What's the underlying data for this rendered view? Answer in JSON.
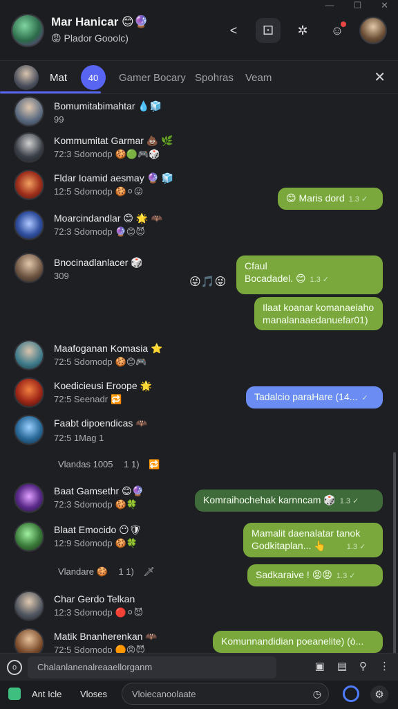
{
  "window": {
    "minimize": "—",
    "maximize": "☐",
    "close": "✕"
  },
  "header": {
    "name": "Mar Hanicar 😊🔮",
    "status": "😡 Plador Gooolc)",
    "actions": [
      "share-icon",
      "dice-icon",
      "settings-icon",
      "notification-icon"
    ]
  },
  "tabs": {
    "me_label": "Mat",
    "badge": "40",
    "items": [
      "Gamer Bocary",
      "Spohras",
      "Veam"
    ],
    "close": "✕"
  },
  "contacts": [
    {
      "name": "Bomumitabimahtar 💧🧊",
      "meta": "99",
      "emoji": ""
    },
    {
      "name": "Kommumitat Garmar 💩 🌿",
      "meta": "72:3 Sdomodp",
      "emoji": "🍪🟢🎮🎲"
    },
    {
      "name": "Fldar Ioamid aesmay 🔮 🧊",
      "meta": "12:5 Sdomodp",
      "emoji": "🍪⚪😜"
    },
    {
      "name": "Moarcindandlar 😊 🌟 🦇",
      "meta": "72:3 Sdomodp",
      "emoji": "🔮😊😈"
    },
    {
      "name": "Bnocinadlanlacer 🎲",
      "meta": "309",
      "emoji": ""
    },
    {
      "name": "Maafoganan Komasia ⭐",
      "meta": "72:5 Sdomodp",
      "emoji": "🍪😊🎮"
    },
    {
      "name": "Koedicieusi Eroope 🌟",
      "meta": "72:5 Seenadr",
      "emoji": "🔁"
    },
    {
      "name": "Faabt dipoendicas 🦇",
      "meta": "72:5 1Mag 1",
      "emoji": ""
    },
    {
      "name": "Baat Gamsethr 😊🔮",
      "meta": "72:3 Sdomodp",
      "emoji": "🍪🍀"
    },
    {
      "name": "Blaat Emocido 😶🛡",
      "meta": "12:9 Sdomodp",
      "emoji": "🍪🍀"
    },
    {
      "name": "Char Gerdo Telkan",
      "meta": "12:3 Sdomodp",
      "emoji": "🔴⚪😈"
    },
    {
      "name": "Matik Bnanherenkan 🦇",
      "meta": "72:5 Sdomodp",
      "emoji": "🟠😡😈"
    }
  ],
  "messages": [
    {
      "text": "😊 Maris dord",
      "tick": "1.3 ✓"
    },
    {
      "text": "Cfaul",
      "text2": "Bocadadel. 😊",
      "tick": "1.3 ✓",
      "reactions": "😜🎵😜"
    },
    {
      "text": "Ilaat koanar komanaeiaho",
      "text2": "manalanaaedanuefar01)"
    },
    {
      "text": "Tadalcio paraHare (14...",
      "tick": "✓"
    },
    {
      "text": "Komraihochehak karnncam 🎲",
      "tick": "1.3 ✓"
    },
    {
      "text": "Mamalit daenalatar tanok",
      "text2": "Godkitaplan... 👆",
      "tick": "1.3 ✓"
    },
    {
      "text": "Sadkaraive ! 😡😡",
      "tick": "1.3 ✓"
    },
    {
      "text": "Komunnandidian poeanelite) (ò..."
    }
  ],
  "separators": [
    {
      "label": "Vlandas 1005",
      "count": "1 1)",
      "mark": "🔁"
    },
    {
      "label": "Vlandare 🍪",
      "count": "1 1)",
      "mark": "🗡"
    }
  ],
  "composer": {
    "placeholder": "Chalanlanenalreaaellorganm",
    "icons": [
      "image-icon",
      "sticker-icon",
      "search-icon",
      "more-icon"
    ]
  },
  "bottom": {
    "label1": "Ant Icle",
    "label2": "Vloses",
    "field": "Vloiecanoolaate"
  },
  "colors": {
    "accent": "#5865f2",
    "bubble_green": "#7aa83c",
    "bubble_dark_green": "#3f6b3a",
    "bubble_blue": "#6b8cf2"
  }
}
